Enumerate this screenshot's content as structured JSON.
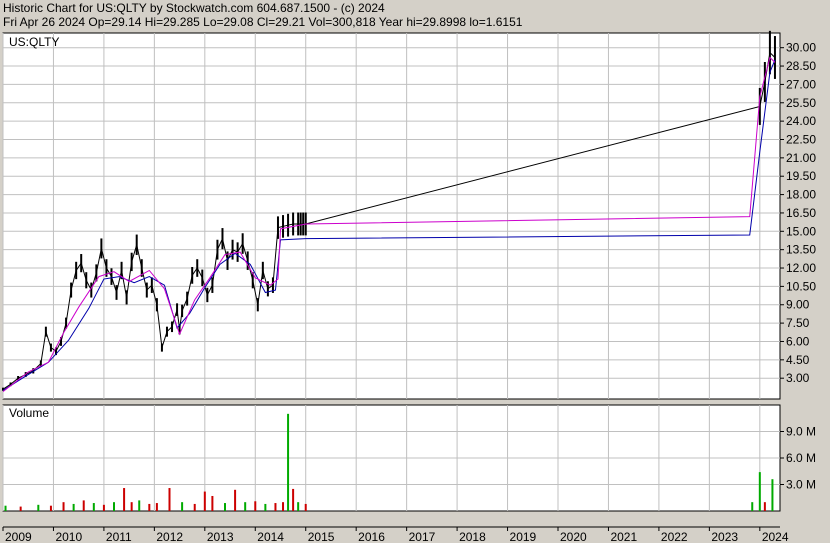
{
  "header": {
    "line1": "Historic Chart for US:QLTY by Stockwatch.com 604.687.1500 - (c) 2024",
    "line2": "Fri Apr 26 2024   Op=29.14   Hi=29.285   Lo=29.08   Cl=29.21   Vol=300,818   Year hi=29.8998   lo=1.6151"
  },
  "price_panel": {
    "symbol_label": "US:QLTY"
  },
  "volume_panel": {
    "title": "Volume"
  },
  "colors": {
    "background": "#d4d0c8",
    "plot_bg": "#ffffff",
    "grid": "#c0c0c0",
    "price_bars": "#000000",
    "ma_short": "#cc00cc",
    "ma_long": "#0000aa",
    "volume_up": "#00aa00",
    "volume_down": "#cc0000"
  },
  "chart_data": [
    {
      "type": "line",
      "panel": "price",
      "y_ticks": [
        "30.00",
        "28.50",
        "27.00",
        "25.50",
        "24.00",
        "22.50",
        "21.00",
        "19.50",
        "18.00",
        "16.50",
        "15.00",
        "13.50",
        "12.00",
        "10.50",
        "9.00",
        "7.50",
        "6.00",
        "4.50",
        "3.00"
      ],
      "ylim": [
        1.3,
        31.2
      ],
      "x_ticks": [
        "2009",
        "2010",
        "2011",
        "2012",
        "2013",
        "2014",
        "2015",
        "2016",
        "2017",
        "2018",
        "2019",
        "2020",
        "2021",
        "2022",
        "2023",
        "2024"
      ],
      "xlim": [
        2009.0,
        2024.4
      ],
      "series": [
        {
          "role": "price",
          "x": [
            2009.0,
            2009.15,
            2009.3,
            2009.45,
            2009.6,
            2009.75,
            2009.85,
            2009.95,
            2010.05,
            2010.15,
            2010.25,
            2010.35,
            2010.45,
            2010.55,
            2010.65,
            2010.75,
            2010.85,
            2010.95,
            2011.05,
            2011.15,
            2011.25,
            2011.35,
            2011.45,
            2011.55,
            2011.65,
            2011.75,
            2011.85,
            2011.95,
            2012.05,
            2012.15,
            2012.25,
            2012.35,
            2012.45,
            2012.5,
            2012.55,
            2012.65,
            2012.75,
            2012.85,
            2012.95,
            2013.05,
            2013.15,
            2013.25,
            2013.35,
            2013.45,
            2013.55,
            2013.65,
            2013.75,
            2013.85,
            2013.95,
            2014.05,
            2014.15,
            2014.25,
            2014.35,
            2014.45,
            2014.55,
            2014.65,
            2014.75,
            2014.85,
            2014.9,
            2014.95,
            2015.0,
            2024.0,
            2024.1,
            2024.2,
            2024.3
          ],
          "y": [
            2.1,
            2.5,
            3.0,
            3.3,
            3.6,
            4.2,
            6.8,
            5.5,
            5.2,
            6.0,
            7.5,
            10.2,
            11.8,
            12.4,
            11.0,
            10.2,
            11.6,
            13.6,
            12.0,
            11.3,
            10.0,
            11.8,
            9.6,
            12.5,
            13.9,
            12.0,
            10.2,
            10.6,
            9.0,
            5.5,
            6.8,
            7.2,
            8.6,
            7.0,
            8.5,
            9.5,
            11.4,
            12.0,
            11.2,
            9.8,
            10.6,
            13.5,
            14.4,
            12.6,
            13.5,
            13.3,
            14.0,
            12.6,
            11.0,
            9.0,
            11.8,
            10.3,
            10.6,
            15.3,
            15.4,
            15.5,
            15.6,
            15.6,
            15.6,
            15.6,
            15.6,
            25.2,
            27.2,
            29.6,
            29.2
          ]
        },
        {
          "role": "ma_short",
          "x": [
            2009.0,
            2009.5,
            2009.9,
            2010.2,
            2010.5,
            2010.9,
            2011.2,
            2011.5,
            2011.9,
            2012.2,
            2012.5,
            2012.8,
            2013.1,
            2013.4,
            2013.7,
            2014.0,
            2014.3,
            2014.45,
            2014.5,
            2015.0,
            2023.8,
            2024.0,
            2024.2,
            2024.3
          ],
          "y": [
            1.9,
            3.5,
            4.3,
            6.7,
            8.8,
            11.3,
            11.7,
            10.9,
            11.8,
            10.3,
            6.6,
            9.4,
            11.2,
            13.1,
            13.3,
            11.2,
            10.6,
            11.1,
            15.2,
            15.6,
            16.2,
            26.0,
            29.2,
            28.8
          ]
        },
        {
          "role": "ma_long",
          "x": [
            2009.0,
            2009.5,
            2009.9,
            2010.3,
            2010.7,
            2011.0,
            2011.3,
            2011.6,
            2011.9,
            2012.2,
            2012.45,
            2012.7,
            2013.0,
            2013.3,
            2013.6,
            2013.9,
            2014.2,
            2014.4,
            2014.5,
            2015.0,
            2023.8,
            2024.0,
            2024.2,
            2024.3
          ],
          "y": [
            2.0,
            3.3,
            4.3,
            6.1,
            8.7,
            11.1,
            11.3,
            10.8,
            11.3,
            10.6,
            7.1,
            8.3,
            10.4,
            12.3,
            13.2,
            12.3,
            10.0,
            10.2,
            14.3,
            14.4,
            14.7,
            21.5,
            28.0,
            29.0
          ]
        }
      ]
    },
    {
      "type": "bar",
      "panel": "volume",
      "y_ticks": [
        "9.0 M",
        "6.0 M",
        "3.0 M"
      ],
      "ylim": [
        0,
        12.0
      ],
      "unit": "M",
      "x": [
        2009.05,
        2009.35,
        2009.7,
        2009.95,
        2010.2,
        2010.4,
        2010.6,
        2010.8,
        2011.0,
        2011.2,
        2011.4,
        2011.55,
        2011.7,
        2011.9,
        2012.05,
        2012.3,
        2012.55,
        2012.8,
        2013.0,
        2013.15,
        2013.4,
        2013.6,
        2013.8,
        2014.0,
        2014.2,
        2014.4,
        2014.55,
        2014.65,
        2014.75,
        2014.85,
        2015.0,
        2023.85,
        2024.0,
        2024.1,
        2024.25
      ],
      "values": [
        0.6,
        0.5,
        0.7,
        0.6,
        1.0,
        0.8,
        1.2,
        0.9,
        0.7,
        1.0,
        2.6,
        1.0,
        1.2,
        0.8,
        0.9,
        2.6,
        1.0,
        0.8,
        2.2,
        1.7,
        0.9,
        2.4,
        1.0,
        1.1,
        0.8,
        0.9,
        1.0,
        11.0,
        2.5,
        1.0,
        0.8,
        1.0,
        4.4,
        1.0,
        3.6
      ],
      "colors": [
        "g",
        "r",
        "g",
        "r",
        "r",
        "g",
        "r",
        "g",
        "r",
        "g",
        "r",
        "r",
        "g",
        "r",
        "r",
        "r",
        "g",
        "r",
        "r",
        "r",
        "g",
        "r",
        "g",
        "r",
        "g",
        "r",
        "r",
        "g",
        "r",
        "g",
        "r",
        "g",
        "g",
        "r",
        "g"
      ]
    }
  ]
}
